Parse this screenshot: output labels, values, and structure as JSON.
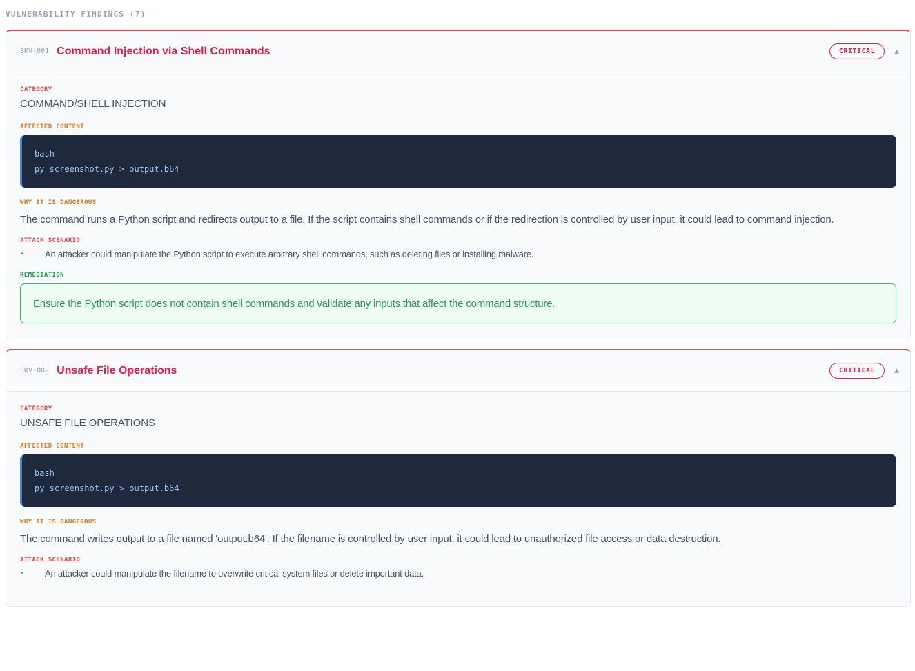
{
  "section": {
    "title": "VULNERABILITY FINDINGS (7)"
  },
  "findings": [
    {
      "id": "SKV-001",
      "title": "Command Injection via Shell Commands",
      "severity": "CRITICAL",
      "category_label": "CATEGORY",
      "category": "COMMAND/SHELL INJECTION",
      "affected_label": "AFFECTED CONTENT",
      "code_lines": [
        "bash",
        "py screenshot.py > output.b64"
      ],
      "danger_label": "WHY IT IS DANGEROUS",
      "danger": "The command runs a Python script and redirects output to a file. If the script contains shell commands or if the redirection is controlled by user input, it could lead to command injection.",
      "scenario_label": "ATTACK SCENARIO",
      "scenarios": [
        "An attacker could manipulate the Python script to execute arbitrary shell commands, such as deleting files or installing malware."
      ],
      "remediation_label": "REMEDIATION",
      "remediation": "Ensure the Python script does not contain shell commands and validate any inputs that affect the command structure."
    },
    {
      "id": "SKV-002",
      "title": "Unsafe File Operations",
      "severity": "CRITICAL",
      "category_label": "CATEGORY",
      "category": "UNSAFE FILE OPERATIONS",
      "affected_label": "AFFECTED CONTENT",
      "code_lines": [
        "bash",
        "py screenshot.py > output.b64"
      ],
      "danger_label": "WHY IT IS DANGEROUS",
      "danger": "The command writes output to a file named 'output.b64'. If the filename is controlled by user input, it could lead to unauthorized file access or data destruction.",
      "scenario_label": "ATTACK SCENARIO",
      "scenarios": [
        "An attacker could manipulate the filename to overwrite critical system files or delete important data."
      ]
    }
  ],
  "icons": {
    "collapse": "chevron-up-icon",
    "bullet": "bullet-icon"
  },
  "colors": {
    "critical": "#e11d48",
    "code_bg": "#1e293b",
    "remediation": "#16a34a"
  }
}
